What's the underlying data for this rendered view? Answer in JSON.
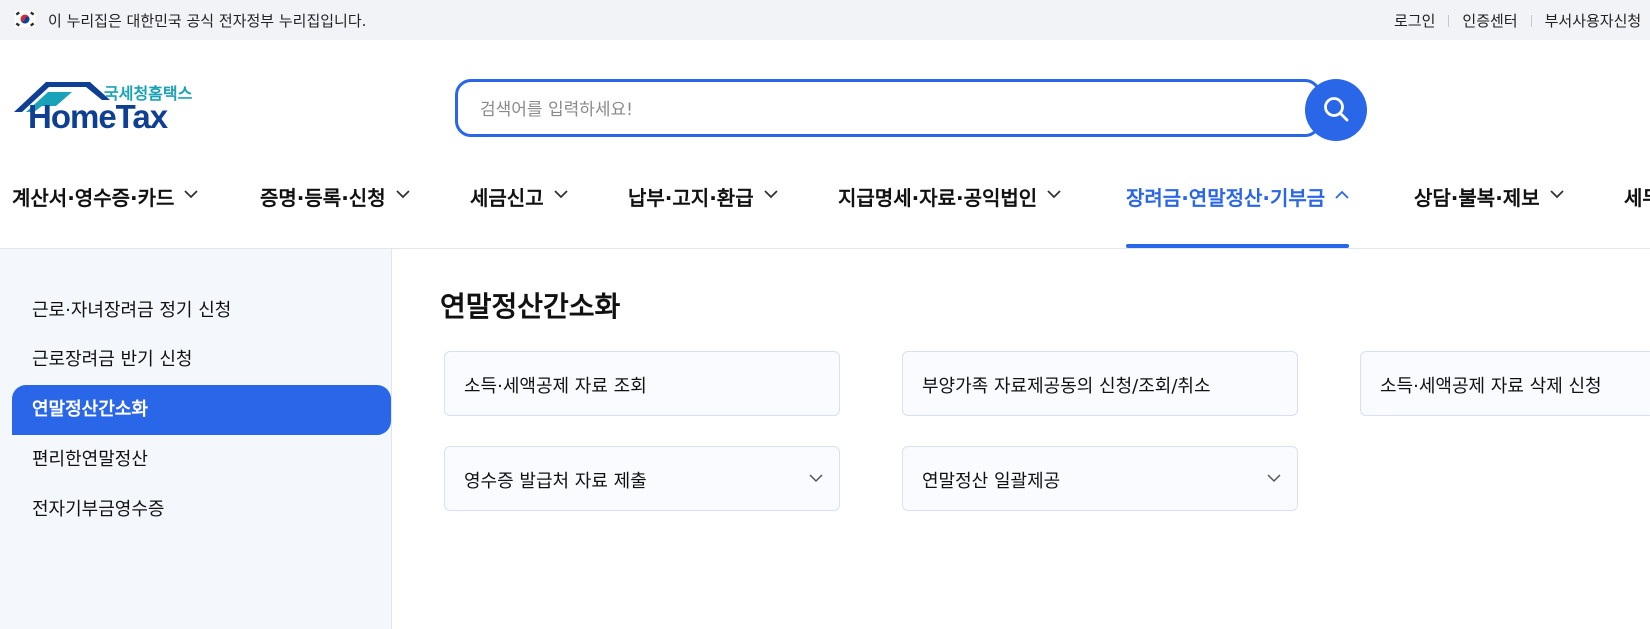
{
  "gov_banner": {
    "text": "이 누리집은 대한민국 공식 전자정부 누리집입니다.",
    "links": [
      "로그인",
      "인증센터",
      "부서사용자신청"
    ]
  },
  "logo": {
    "small_text": "국세청홈택스",
    "main_text": "HomeTax"
  },
  "search": {
    "placeholder": "검색어를 입력하세요!",
    "value": ""
  },
  "gnb": [
    {
      "label": "계산서·영수증·카드",
      "active": false
    },
    {
      "label": "증명·등록·신청",
      "active": false
    },
    {
      "label": "세금신고",
      "active": false
    },
    {
      "label": "납부·고지·환급",
      "active": false
    },
    {
      "label": "지급명세·자료·공익법인",
      "active": false
    },
    {
      "label": "장려금·연말정산·기부금",
      "active": true
    },
    {
      "label": "상담·불복·제보",
      "active": false
    },
    {
      "label": "세무대리·납세관리",
      "active": false
    }
  ],
  "sidebar": {
    "items": [
      {
        "label": "근로·자녀장려금 정기 신청",
        "active": false
      },
      {
        "label": "근로장려금 반기 신청",
        "active": false
      },
      {
        "label": "연말정산간소화",
        "active": true
      },
      {
        "label": "편리한연말정산",
        "active": false
      },
      {
        "label": "전자기부금영수증",
        "active": false
      }
    ]
  },
  "main": {
    "title": "연말정산간소화",
    "cards": [
      {
        "label": "소득·세액공제 자료 조회",
        "expandable": false
      },
      {
        "label": "부양가족 자료제공동의 신청/조회/취소",
        "expandable": false
      },
      {
        "label": "소득·세액공제 자료 삭제 신청",
        "expandable": false
      },
      {
        "label": "영수증 발급처 자료 제출",
        "expandable": true
      },
      {
        "label": "연말정산 일괄제공",
        "expandable": true
      }
    ]
  },
  "colors": {
    "accent": "#2a66e8",
    "logo_dark": "#0f3f93",
    "logo_teal": "#1aa3b8",
    "sidebar_bg": "#f4f7fc"
  },
  "icons": {
    "search": "search-icon",
    "chevron": "chevron-down-icon",
    "chevron_up": "chevron-up-icon",
    "flag": "korea-flag-icon"
  }
}
